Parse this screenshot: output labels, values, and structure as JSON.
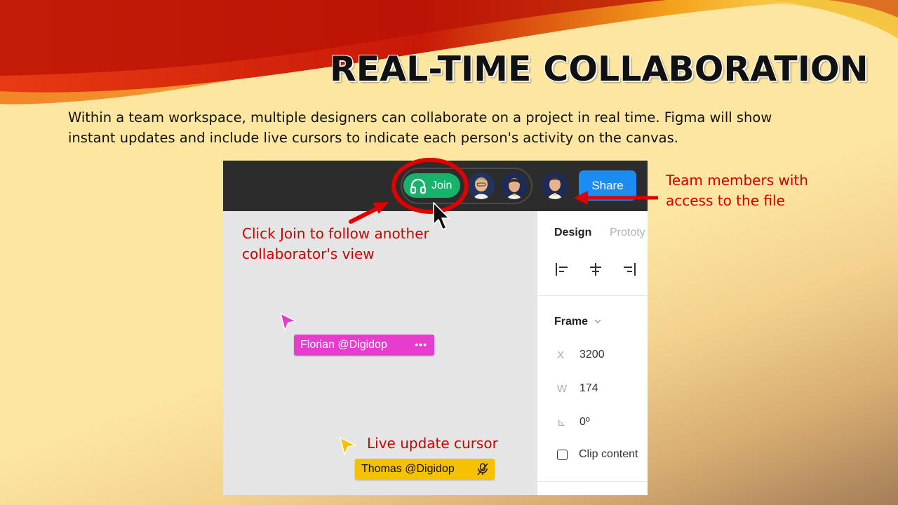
{
  "slide": {
    "title": "REAL-TIME COLLABORATION",
    "description_lines": [
      "Within a team workspace, multiple designers can collaborate on a project in real time. Figma will show",
      "instant updates and include live cursors to indicate each person's activity on the canvas."
    ]
  },
  "toolbar": {
    "join_label": "Join",
    "share_label": "Share",
    "avatars": [
      "avatar-1",
      "avatar-2",
      "avatar-3"
    ]
  },
  "right_panel": {
    "tabs": [
      "Design",
      "Prototy"
    ],
    "align_icons": [
      "align-left-icon",
      "align-center-icon",
      "align-right-icon"
    ],
    "section_title": "Frame",
    "properties": [
      {
        "label": "X",
        "value": "3200"
      },
      {
        "label": "W",
        "value": "174"
      },
      {
        "label": "⊾",
        "value": "0º"
      }
    ],
    "clip_content_label": "Clip content"
  },
  "cursors": {
    "florian": {
      "name": "Florian @Digidop",
      "color": "#e83ccf"
    },
    "thomas": {
      "name": "Thomas @Digidop",
      "color": "#f6c100"
    }
  },
  "annotations": {
    "join_note": [
      "Click Join to follow another",
      "collaborator's view"
    ],
    "team_note": [
      "Team members with",
      "access to the file"
    ],
    "cursor_note": "Live update cursor",
    "color": "#d10000"
  }
}
